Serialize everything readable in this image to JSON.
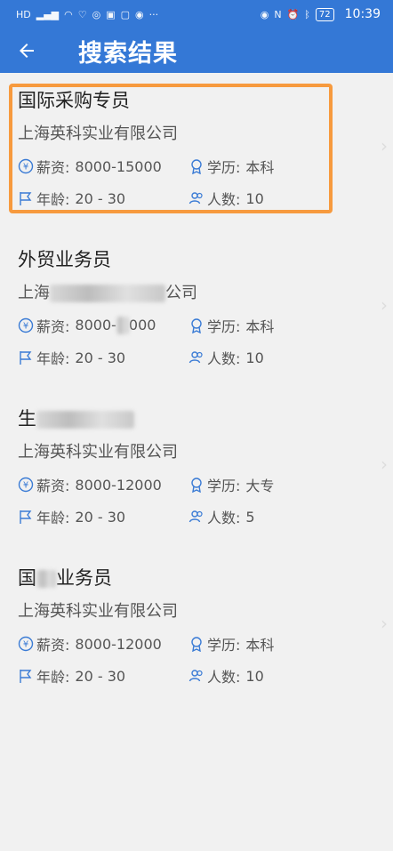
{
  "status_bar": {
    "left_icons": [
      "HD",
      "4G",
      "signal",
      "wifi",
      "heart",
      "wechat",
      "app",
      "app",
      "target",
      "more"
    ],
    "battery": "72",
    "time": "10:39"
  },
  "header": {
    "title": "搜索结果"
  },
  "labels": {
    "salary": "薪资:",
    "education": "学历:",
    "age": "年龄:",
    "headcount": "人数:"
  },
  "jobs": [
    {
      "title": "国际采购专员",
      "company": "上海英科实业有限公司",
      "salary": "8000-15000",
      "education": "本科",
      "age": "20 - 30",
      "headcount": "10"
    },
    {
      "title": "外贸业务员",
      "company_prefix": "上海",
      "company_suffix": "公司",
      "salary_prefix": "8000-",
      "salary_suffix": "000",
      "education": "本科",
      "age": "20 - 30",
      "headcount": "10"
    },
    {
      "title_prefix": "生",
      "company": "上海英科实业有限公司",
      "salary": "8000-12000",
      "education": "大专",
      "age": "20 - 30",
      "headcount": "5"
    },
    {
      "title_prefix": "国",
      "title_suffix": "业务员",
      "company": "上海英科实业有限公司",
      "salary": "8000-12000",
      "education": "本科",
      "age": "20 - 30",
      "headcount": "10"
    }
  ]
}
